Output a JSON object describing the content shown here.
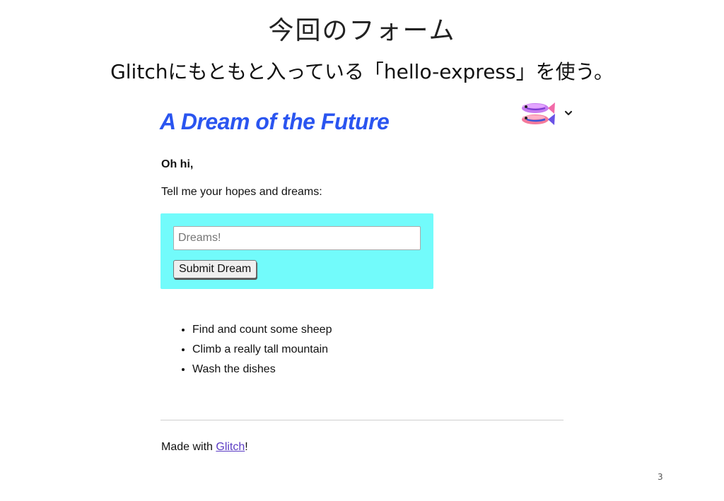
{
  "slide": {
    "title": "今回のフォーム",
    "subtitle": "Glitchにもともと入っている「hello-express」を使う。",
    "page_number": "3"
  },
  "app": {
    "heading": "A Dream of the Future",
    "greeting": "Oh hi,",
    "prompt": "Tell me your hopes and dreams:",
    "input_placeholder": "Dreams!",
    "submit_label": "Submit Dream",
    "dreams": [
      "Find and count some sheep",
      "Climb a really tall mountain",
      "Wash the dishes"
    ],
    "footer_prefix": "Made with ",
    "footer_link": "Glitch",
    "footer_suffix": "!",
    "accent_color": "#2a55f0",
    "form_bg_color": "#72fbfb",
    "link_color": "#5b3cc4"
  },
  "icons": {
    "fish": "glitch-fish-icon",
    "chevron": "chevron-down-icon"
  }
}
